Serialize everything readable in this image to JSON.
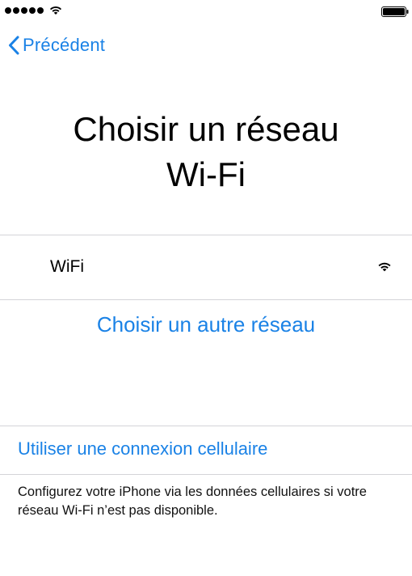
{
  "status_bar": {
    "signal_icon": "signal-dots-icon",
    "wifi_icon": "wifi-icon",
    "battery_icon": "battery-icon"
  },
  "nav": {
    "back_label": "Précédent",
    "back_icon": "chevron-left-icon"
  },
  "title": {
    "line1": "Choisir un réseau",
    "line2": "Wi-Fi"
  },
  "networks": [
    {
      "name": "WiFi",
      "icon": "wifi-icon"
    }
  ],
  "other_network_label": "Choisir un autre réseau",
  "cellular": {
    "link_label": "Utiliser une connexion cellulaire",
    "note": "Configurez votre iPhone via les données cellulaires si votre réseau Wi-Fi n’est pas disponible."
  },
  "colors": {
    "accent": "#1a82e6",
    "separator": "#d4d4d8",
    "text": "#000000"
  }
}
